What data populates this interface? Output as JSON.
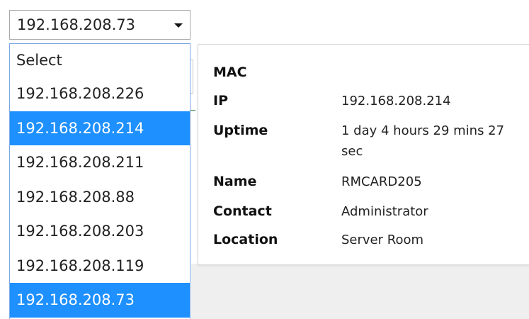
{
  "device_select": {
    "selected": "192.168.208.73",
    "options": [
      "Select",
      "192.168.208.226",
      "192.168.208.214",
      "192.168.208.211",
      "192.168.208.88",
      "192.168.208.203",
      "192.168.208.119",
      "192.168.208.73"
    ],
    "hover_option": "192.168.208.214"
  },
  "info": {
    "mac_label": "MAC",
    "mac_value": "",
    "ip_label": "IP",
    "ip_value": "192.168.208.214",
    "uptime_label": "Uptime",
    "uptime_value": "1 day 4 hours 29 mins 27 sec",
    "name_label": "Name",
    "name_value": "RMCARD205",
    "contact_label": "Contact",
    "contact_value": "Administrator",
    "location_label": "Location",
    "location_value": "Server Room"
  },
  "colors": {
    "highlight": "#1e90ff",
    "dropdown_border": "#7aa7e6"
  },
  "icons": {
    "select_arrow": "caret-down-icon"
  }
}
